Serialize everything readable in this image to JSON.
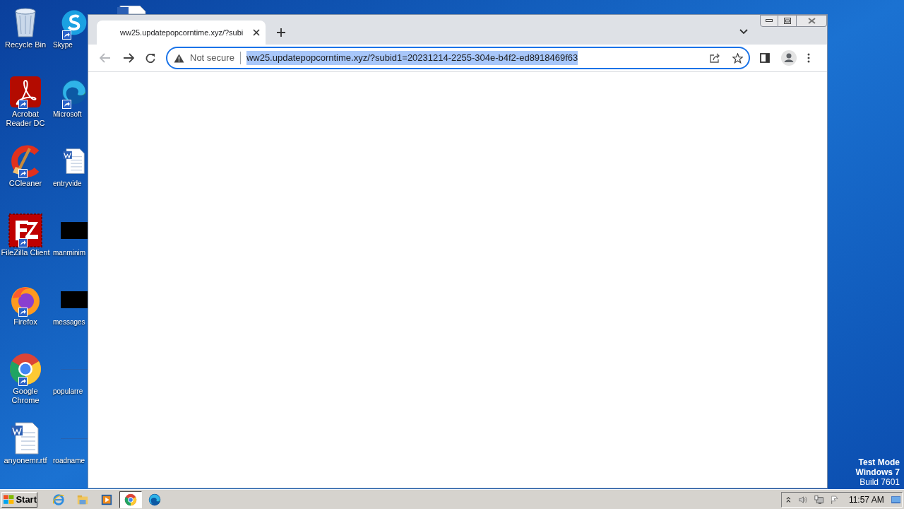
{
  "desktop_icons": [
    {
      "label": "Recycle Bin",
      "kind": "recycle",
      "shortcut": false
    },
    {
      "label": "Acrobat Reader DC",
      "kind": "acrobat",
      "shortcut": true
    },
    {
      "label": "CCleaner",
      "kind": "ccleaner",
      "shortcut": true
    },
    {
      "label": "FileZilla Client",
      "kind": "filezilla",
      "shortcut": true
    },
    {
      "label": "Firefox",
      "kind": "firefox",
      "shortcut": true
    },
    {
      "label": "Google Chrome",
      "kind": "chrome",
      "shortcut": true
    },
    {
      "label": "anyonemr.rtf",
      "kind": "word",
      "shortcut": false
    },
    {
      "label": "Skype",
      "kind": "skype",
      "shortcut": true
    },
    {
      "label": "Microsoft",
      "kind": "edge",
      "shortcut": true
    },
    {
      "label": "entryvide",
      "kind": "word",
      "shortcut": false
    },
    {
      "label": "manminim",
      "kind": "black",
      "shortcut": false
    },
    {
      "label": "messages",
      "kind": "black",
      "shortcut": false
    },
    {
      "label": "popularre",
      "kind": "blank",
      "shortcut": false
    },
    {
      "label": "roadname",
      "kind": "blank",
      "shortcut": false
    }
  ],
  "browser": {
    "tab": {
      "title": "ww25.updatepopcorntime.xyz/?subi",
      "selected": true
    },
    "back_disabled": true,
    "address": {
      "security": "Not secure",
      "url": "ww25.updatepopcorntime.xyz/?subid1=20231214-2255-304e-b4f2-ed8918469f63",
      "url_selected": true
    }
  },
  "os_notice": [
    "Test Mode",
    "Windows 7",
    "Build 7601"
  ],
  "taskbar": {
    "start": "Start",
    "apps": [
      {
        "kind": "ie",
        "selected": false
      },
      {
        "kind": "explorer",
        "selected": false
      },
      {
        "kind": "media",
        "selected": false
      },
      {
        "kind": "chrome",
        "selected": true
      },
      {
        "kind": "edge",
        "selected": false
      }
    ],
    "clock": "11:57 AM"
  }
}
